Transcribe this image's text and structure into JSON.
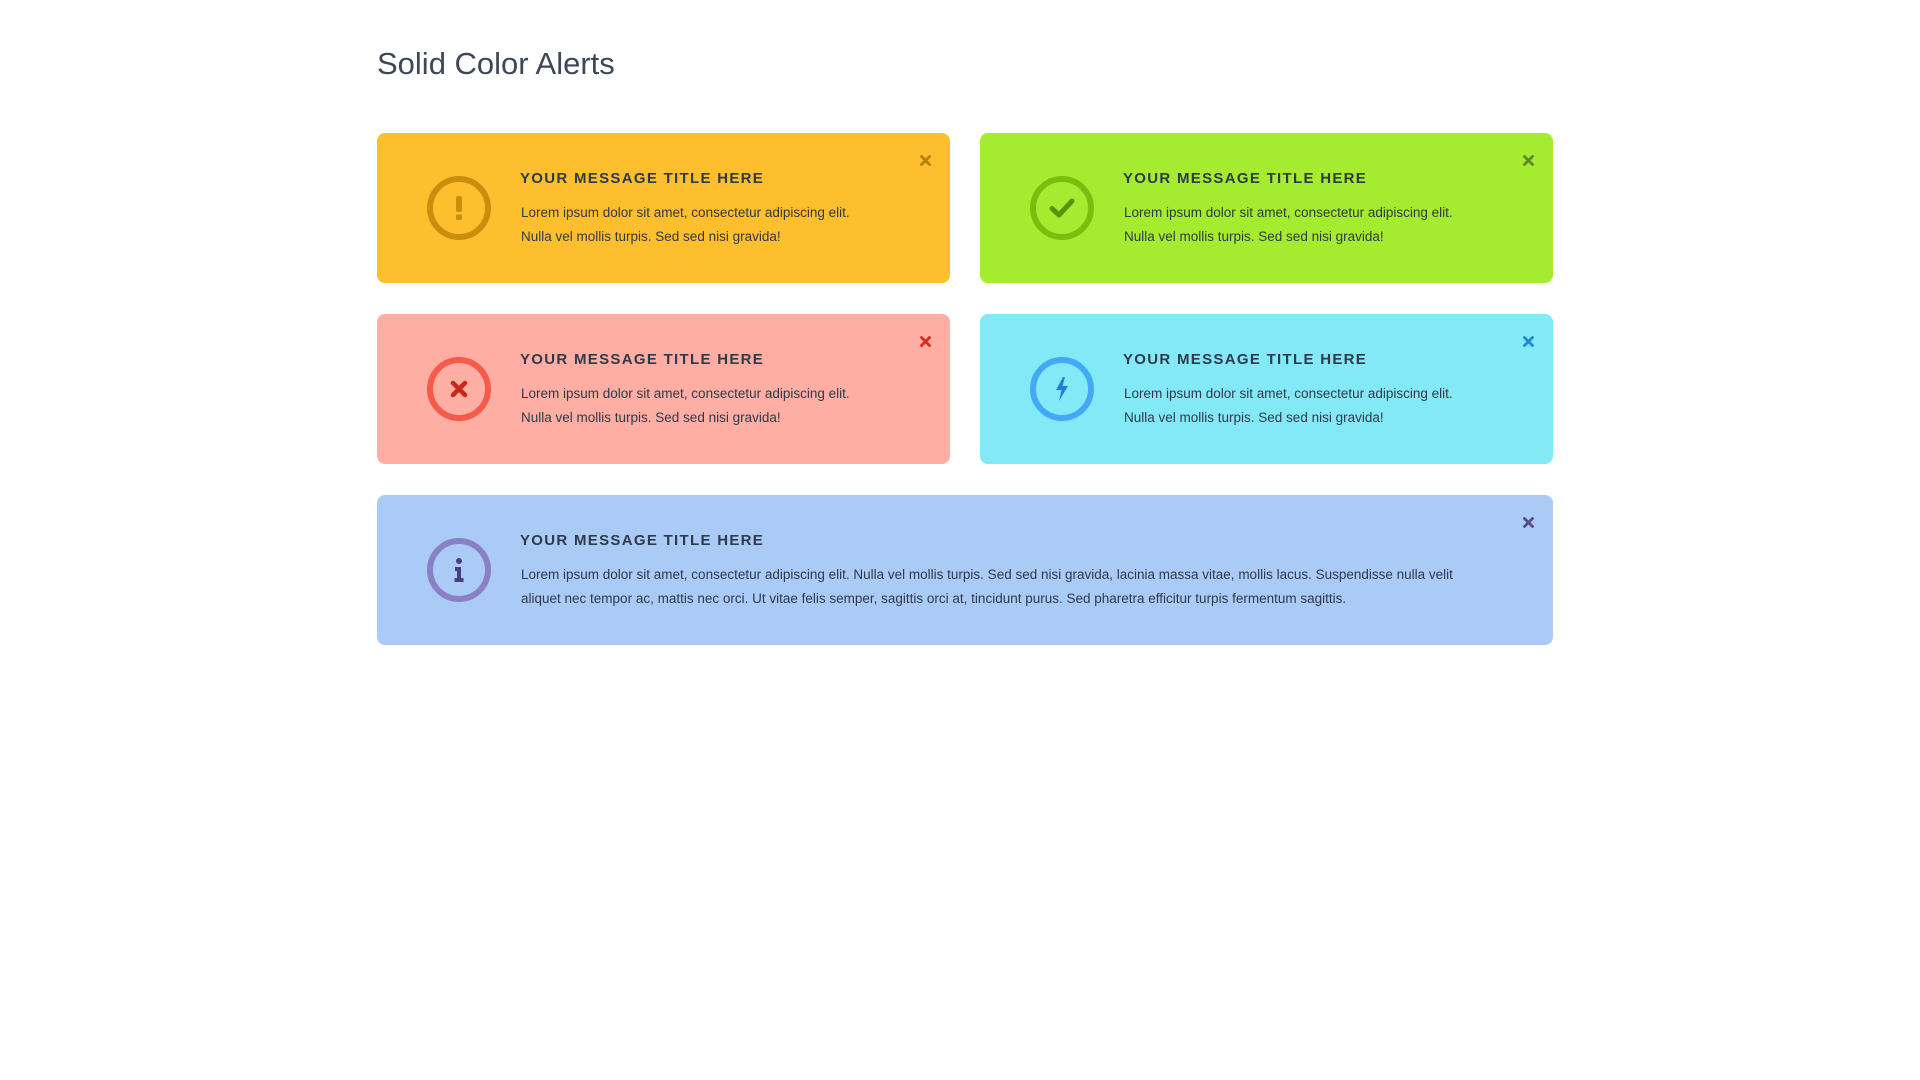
{
  "page": {
    "title": "Solid Color Alerts"
  },
  "colors": {
    "warning": "#fdbf2d",
    "success": "#a5eb2f",
    "danger": "#ffaea3",
    "notice": "#84e9f7",
    "info": "#aacbf5"
  },
  "alerts": [
    {
      "type": "warning",
      "icon": "exclamation-icon",
      "title": "YOUR MESSAGE TITLE HERE",
      "line1": "Lorem ipsum dolor sit amet, consectetur adipiscing elit.",
      "line2": "Nulla vel mollis turpis. Sed sed nisi gravida!"
    },
    {
      "type": "success",
      "icon": "checkmark-icon",
      "title": "YOUR MESSAGE TITLE HERE",
      "line1": "Lorem ipsum dolor sit amet, consectetur adipiscing elit.",
      "line2": "Nulla vel mollis turpis. Sed sed nisi gravida!"
    },
    {
      "type": "danger",
      "icon": "x-mark-icon",
      "title": "YOUR MESSAGE TITLE HERE",
      "line1": "Lorem ipsum dolor sit amet, consectetur adipiscing elit.",
      "line2": "Nulla vel mollis turpis. Sed sed nisi gravida!"
    },
    {
      "type": "notice",
      "icon": "lightning-bolt-icon",
      "title": "YOUR MESSAGE TITLE HERE",
      "line1": "Lorem ipsum dolor sit amet, consectetur adipiscing elit.",
      "line2": "Nulla vel mollis turpis. Sed sed nisi gravida!"
    },
    {
      "type": "info",
      "icon": "info-icon",
      "title": "YOUR MESSAGE TITLE HERE",
      "line1": "Lorem ipsum dolor sit amet, consectetur adipiscing elit. Nulla vel mollis turpis. Sed sed nisi gravida, lacinia massa vitae, mollis lacus. Suspendisse nulla velit",
      "line2": "aliquet nec tempor ac, mattis nec orci. Ut vitae felis semper, sagittis orci at, tincidunt purus. Sed pharetra efficitur turpis fermentum sagittis."
    }
  ]
}
